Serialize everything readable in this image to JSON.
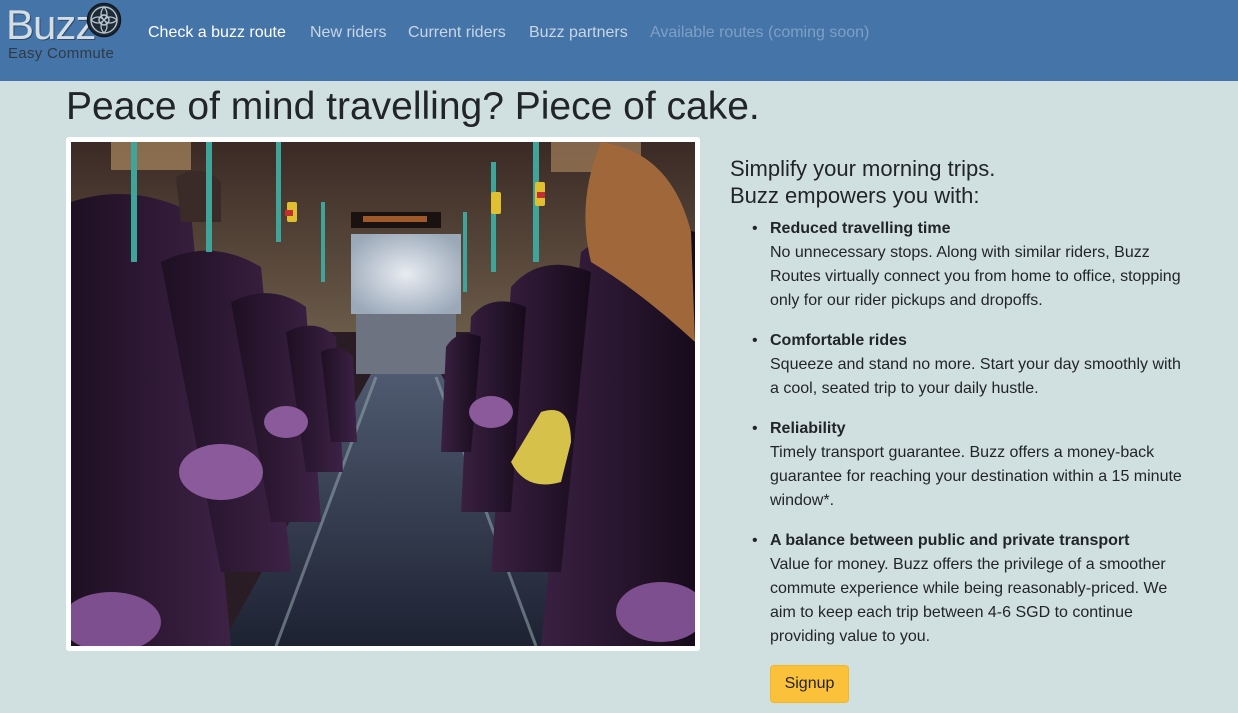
{
  "brand": {
    "name": "Buzz",
    "tagline": "Easy Commute",
    "icon": "compass-wheel-icon"
  },
  "nav": {
    "items": [
      {
        "label": "Check a buzz route",
        "state": "active"
      },
      {
        "label": "New riders",
        "state": "normal"
      },
      {
        "label": "Current riders",
        "state": "normal"
      },
      {
        "label": "Buzz partners",
        "state": "normal"
      },
      {
        "label": "Available routes (coming soon)",
        "state": "disabled"
      }
    ]
  },
  "main": {
    "headline": "Peace of mind travelling? Piece of cake.",
    "image": {
      "subject": "bus-interior-photo"
    },
    "intro_line1": "Simplify your morning trips.",
    "intro_line2": "Buzz empowers you with:",
    "features": [
      {
        "title": "Reduced travelling time",
        "description": "No unnecessary stops. Along with similar riders, Buzz Routes virtually connect you from home to office, stopping only for our rider pickups and dropoffs."
      },
      {
        "title": "Comfortable rides",
        "description": "Squeeze and stand no more. Start your day smoothly with a cool, seated trip to your daily hustle."
      },
      {
        "title": "Reliability",
        "description": "Timely transport guarantee. Buzz offers a money-back guarantee for reaching your destination within a 15 minute window*."
      },
      {
        "title": "A balance between public and private transport",
        "description": "Value for money. Buzz offers the privilege of a smoother commute experience while being reasonably-priced. We aim to keep each trip between 4-6 SGD to continue providing value to you."
      }
    ],
    "signup_label": "Signup"
  },
  "colors": {
    "navbar": "#4574a8",
    "page_background": "#d0dfdf",
    "signup_button": "#fbc13a"
  }
}
